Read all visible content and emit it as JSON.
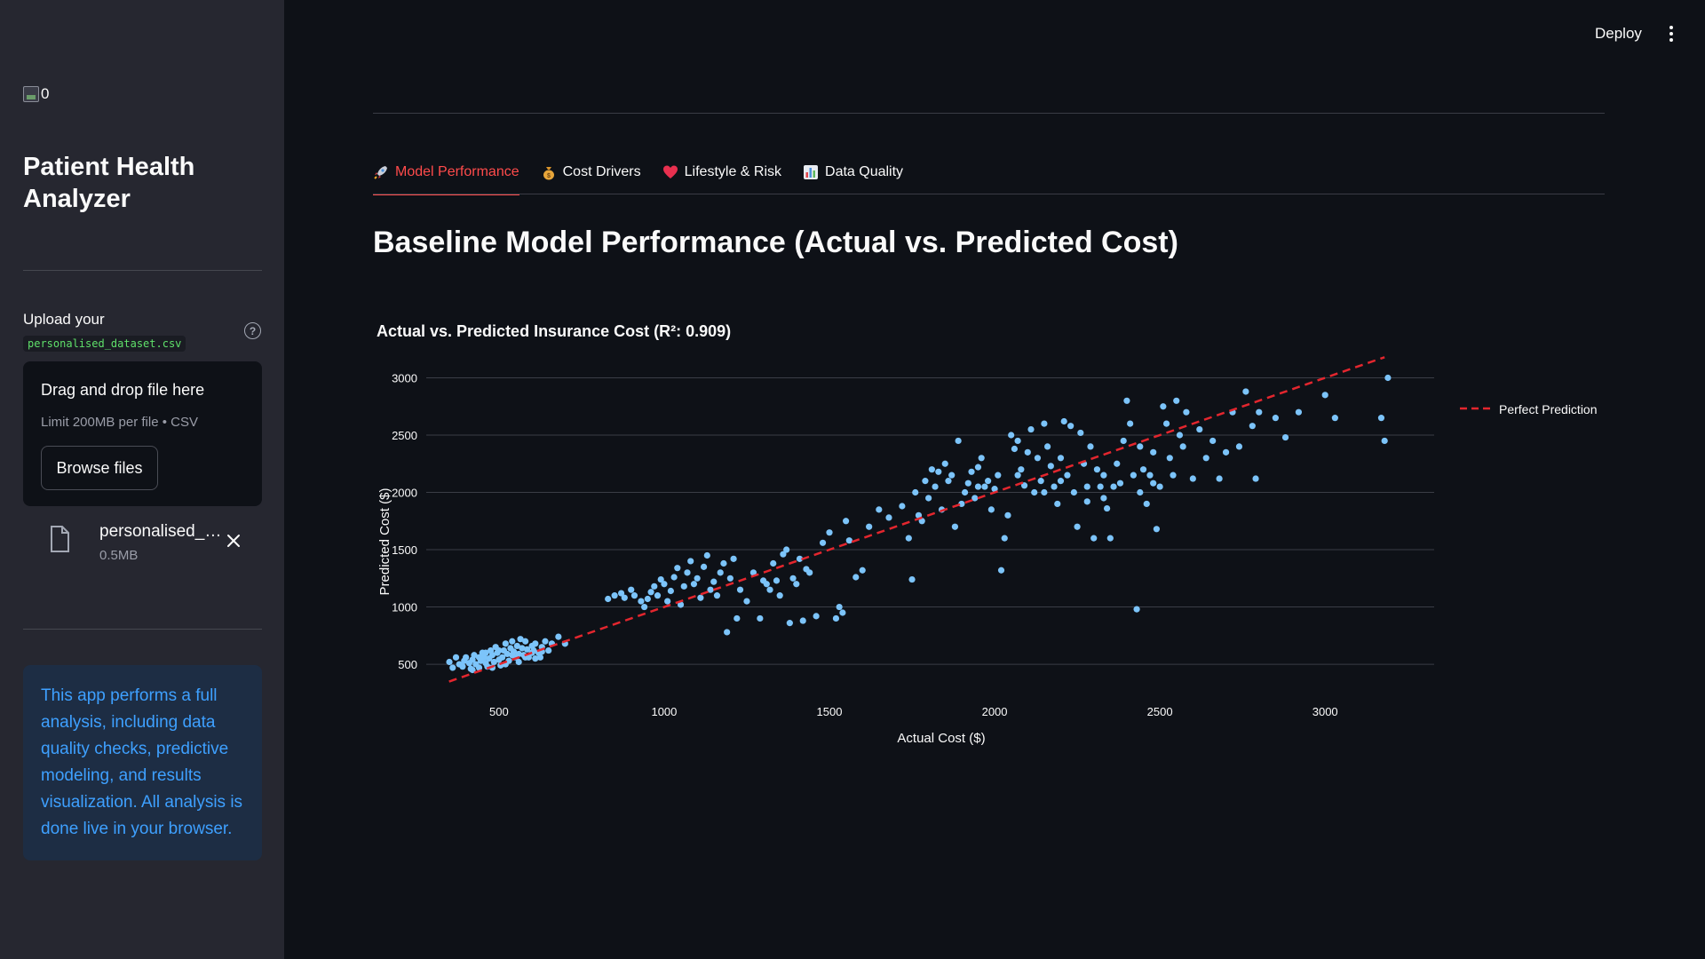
{
  "sidebar": {
    "logo_alt": "0",
    "app_title": "Patient Health Analyzer",
    "upload": {
      "label": "Upload your",
      "filename_code": "personalised_dataset.csv",
      "help_icon": "question-circle-icon",
      "dropzone_title": "Drag and drop file here",
      "dropzone_limit": "Limit 200MB per file • CSV",
      "browse_label": "Browse files"
    },
    "uploaded_file": {
      "name": "personalised_dataset.csv",
      "size": "0.5MB"
    },
    "info_text": "This app performs a full analysis, including data quality checks, predictive modeling, and results visualization. All analysis is done live in your browser."
  },
  "header": {
    "deploy_label": "Deploy",
    "menu_icon": "kebab-menu-icon"
  },
  "tabs": [
    {
      "label": "Model Performance",
      "icon": "rocket",
      "active": true
    },
    {
      "label": "Cost Drivers",
      "icon": "money-bag",
      "active": false
    },
    {
      "label": "Lifestyle & Risk",
      "icon": "heart",
      "active": false
    },
    {
      "label": "Data Quality",
      "icon": "bar-chart",
      "active": false
    }
  ],
  "page_title": "Baseline Model Performance (Actual vs. Predicted Cost)",
  "colors": {
    "accent": "#ff4b4b",
    "points": "#7cc4fa",
    "fit_line": "#e3262e",
    "info_text": "#3ea0ff"
  },
  "chart_data": {
    "type": "scatter",
    "title": "Actual vs. Predicted Insurance Cost (R²: 0.909)",
    "xlabel": "Actual Cost ($)",
    "ylabel": "Predicted Cost ($)",
    "xlim": [
      280,
      3330
    ],
    "ylim": [
      330,
      3120
    ],
    "xticks": [
      500,
      1000,
      1500,
      2000,
      2500,
      3000
    ],
    "yticks": [
      500,
      1000,
      1500,
      2000,
      2500,
      3000
    ],
    "grid": "horizontal",
    "legend_position": "top-right",
    "series": [
      {
        "type": "scatter",
        "points": [
          [
            350,
            520
          ],
          [
            360,
            470
          ],
          [
            370,
            560
          ],
          [
            380,
            500
          ],
          [
            390,
            480
          ],
          [
            395,
            530
          ],
          [
            400,
            560
          ],
          [
            410,
            510
          ],
          [
            415,
            460
          ],
          [
            420,
            540
          ],
          [
            425,
            580
          ],
          [
            430,
            500
          ],
          [
            440,
            470
          ],
          [
            445,
            530
          ],
          [
            450,
            600
          ],
          [
            455,
            560
          ],
          [
            460,
            510
          ],
          [
            465,
            480
          ],
          [
            470,
            550
          ],
          [
            475,
            620
          ],
          [
            480,
            580
          ],
          [
            485,
            520
          ],
          [
            490,
            650
          ],
          [
            495,
            600
          ],
          [
            500,
            540
          ],
          [
            505,
            490
          ],
          [
            510,
            560
          ],
          [
            515,
            620
          ],
          [
            520,
            680
          ],
          [
            525,
            590
          ],
          [
            530,
            530
          ],
          [
            535,
            640
          ],
          [
            540,
            700
          ],
          [
            545,
            610
          ],
          [
            550,
            560
          ],
          [
            555,
            660
          ],
          [
            560,
            590
          ],
          [
            565,
            720
          ],
          [
            570,
            640
          ],
          [
            575,
            580
          ],
          [
            580,
            700
          ],
          [
            585,
            630
          ],
          [
            590,
            560
          ],
          [
            600,
            660
          ],
          [
            605,
            620
          ],
          [
            610,
            680
          ],
          [
            620,
            600
          ],
          [
            625,
            560
          ],
          [
            630,
            650
          ],
          [
            640,
            700
          ],
          [
            650,
            620
          ],
          [
            660,
            680
          ],
          [
            680,
            740
          ],
          [
            700,
            680
          ],
          [
            420,
            450
          ],
          [
            440,
            560
          ],
          [
            460,
            600
          ],
          [
            480,
            470
          ],
          [
            500,
            620
          ],
          [
            520,
            500
          ],
          [
            540,
            580
          ],
          [
            560,
            520
          ],
          [
            580,
            560
          ],
          [
            600,
            600
          ],
          [
            610,
            550
          ],
          [
            630,
            610
          ],
          [
            830,
            1070
          ],
          [
            850,
            1100
          ],
          [
            870,
            1120
          ],
          [
            880,
            1080
          ],
          [
            900,
            1150
          ],
          [
            910,
            1100
          ],
          [
            930,
            1050
          ],
          [
            940,
            1000
          ],
          [
            950,
            1070
          ],
          [
            960,
            1130
          ],
          [
            970,
            1180
          ],
          [
            980,
            1100
          ],
          [
            990,
            1240
          ],
          [
            1000,
            1200
          ],
          [
            1010,
            1050
          ],
          [
            1020,
            1140
          ],
          [
            1030,
            1260
          ],
          [
            1040,
            1340
          ],
          [
            1050,
            1020
          ],
          [
            1060,
            1180
          ],
          [
            1070,
            1300
          ],
          [
            1080,
            1400
          ],
          [
            1090,
            1200
          ],
          [
            1100,
            1250
          ],
          [
            1110,
            1080
          ],
          [
            1120,
            1350
          ],
          [
            1130,
            1450
          ],
          [
            1140,
            1150
          ],
          [
            1150,
            1220
          ],
          [
            1160,
            1100
          ],
          [
            1170,
            1300
          ],
          [
            1180,
            1380
          ],
          [
            1190,
            780
          ],
          [
            1200,
            1250
          ],
          [
            1210,
            1420
          ],
          [
            1220,
            900
          ],
          [
            1230,
            1150
          ],
          [
            1250,
            1050
          ],
          [
            1270,
            1300
          ],
          [
            1290,
            900
          ],
          [
            1300,
            1230
          ],
          [
            1310,
            1200
          ],
          [
            1320,
            1150
          ],
          [
            1330,
            1380
          ],
          [
            1340,
            1230
          ],
          [
            1350,
            1100
          ],
          [
            1360,
            1460
          ],
          [
            1370,
            1500
          ],
          [
            1380,
            860
          ],
          [
            1390,
            1250
          ],
          [
            1400,
            1200
          ],
          [
            1410,
            1420
          ],
          [
            1420,
            880
          ],
          [
            1430,
            1330
          ],
          [
            1440,
            1300
          ],
          [
            1460,
            920
          ],
          [
            1480,
            1560
          ],
          [
            1500,
            1650
          ],
          [
            1520,
            900
          ],
          [
            1530,
            1000
          ],
          [
            1540,
            950
          ],
          [
            1550,
            1750
          ],
          [
            1560,
            1580
          ],
          [
            1580,
            1260
          ],
          [
            1600,
            1320
          ],
          [
            1620,
            1700
          ],
          [
            1650,
            1850
          ],
          [
            1680,
            1780
          ],
          [
            1720,
            1880
          ],
          [
            1740,
            1600
          ],
          [
            1750,
            1240
          ],
          [
            1760,
            2000
          ],
          [
            1770,
            1800
          ],
          [
            1780,
            1750
          ],
          [
            1790,
            2100
          ],
          [
            1800,
            1950
          ],
          [
            1810,
            2200
          ],
          [
            1820,
            2050
          ],
          [
            1830,
            2180
          ],
          [
            1840,
            1850
          ],
          [
            1850,
            2250
          ],
          [
            1860,
            2100
          ],
          [
            1870,
            2150
          ],
          [
            1880,
            1700
          ],
          [
            1890,
            2450
          ],
          [
            1900,
            1900
          ],
          [
            1910,
            2000
          ],
          [
            1920,
            2080
          ],
          [
            1930,
            2180
          ],
          [
            1940,
            1950
          ],
          [
            1950,
            2220
          ],
          [
            1960,
            2300
          ],
          [
            1970,
            2050
          ],
          [
            1980,
            2100
          ],
          [
            1990,
            1850
          ],
          [
            2000,
            2030
          ],
          [
            2010,
            2150
          ],
          [
            2020,
            1320
          ],
          [
            2030,
            1600
          ],
          [
            2040,
            1800
          ],
          [
            2050,
            2500
          ],
          [
            2060,
            2380
          ],
          [
            2070,
            2450
          ],
          [
            2080,
            2200
          ],
          [
            2090,
            2060
          ],
          [
            2100,
            2350
          ],
          [
            2110,
            2550
          ],
          [
            2120,
            2000
          ],
          [
            2130,
            2300
          ],
          [
            2140,
            2100
          ],
          [
            2150,
            2600
          ],
          [
            2160,
            2400
          ],
          [
            2170,
            2230
          ],
          [
            2180,
            2050
          ],
          [
            2190,
            1900
          ],
          [
            2200,
            2300
          ],
          [
            2210,
            2620
          ],
          [
            2220,
            2150
          ],
          [
            2230,
            2580
          ],
          [
            2240,
            2000
          ],
          [
            2250,
            1700
          ],
          [
            2260,
            2520
          ],
          [
            2270,
            2250
          ],
          [
            2280,
            2050
          ],
          [
            2290,
            2400
          ],
          [
            2300,
            1600
          ],
          [
            2310,
            2200
          ],
          [
            2320,
            2050
          ],
          [
            2330,
            2150
          ],
          [
            2340,
            1860
          ],
          [
            2350,
            1600
          ],
          [
            2360,
            2050
          ],
          [
            2370,
            2250
          ],
          [
            2380,
            2080
          ],
          [
            2390,
            2450
          ],
          [
            2400,
            2800
          ],
          [
            2410,
            2600
          ],
          [
            2420,
            2150
          ],
          [
            2430,
            980
          ],
          [
            2440,
            2400
          ],
          [
            2450,
            2200
          ],
          [
            2460,
            1900
          ],
          [
            2470,
            2150
          ],
          [
            2480,
            2350
          ],
          [
            2490,
            1680
          ],
          [
            2500,
            2050
          ],
          [
            2510,
            2750
          ],
          [
            2520,
            2600
          ],
          [
            2530,
            2300
          ],
          [
            2540,
            2150
          ],
          [
            2550,
            2800
          ],
          [
            2560,
            2500
          ],
          [
            2570,
            2400
          ],
          [
            2580,
            2700
          ],
          [
            2600,
            2120
          ],
          [
            2620,
            2550
          ],
          [
            2640,
            2300
          ],
          [
            2660,
            2450
          ],
          [
            2680,
            2120
          ],
          [
            2700,
            2350
          ],
          [
            2720,
            2700
          ],
          [
            2740,
            2400
          ],
          [
            2760,
            2880
          ],
          [
            2780,
            2580
          ],
          [
            2790,
            2120
          ],
          [
            2800,
            2700
          ],
          [
            2850,
            2650
          ],
          [
            2880,
            2480
          ],
          [
            2920,
            2700
          ],
          [
            3000,
            2850
          ],
          [
            3030,
            2650
          ],
          [
            3170,
            2650
          ],
          [
            3180,
            2450
          ],
          [
            3190,
            3000
          ],
          [
            2150,
            2000
          ],
          [
            2070,
            2150
          ],
          [
            1950,
            2050
          ],
          [
            2200,
            2100
          ],
          [
            2280,
            1920
          ],
          [
            2330,
            1950
          ],
          [
            2440,
            2000
          ],
          [
            2480,
            2080
          ]
        ]
      },
      {
        "name": "Perfect Prediction",
        "type": "line",
        "style": "dashed",
        "points": [
          [
            349,
            349
          ],
          [
            3180,
            3180
          ]
        ]
      }
    ]
  }
}
